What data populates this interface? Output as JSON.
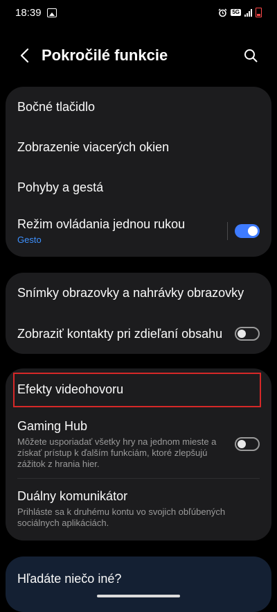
{
  "status_bar": {
    "time": "18:39",
    "network": "5G"
  },
  "header": {
    "title": "Pokročilé funkcie"
  },
  "group1": {
    "items": [
      {
        "label": "Bočné tlačidlo"
      },
      {
        "label": "Zobrazenie viacerých okien"
      },
      {
        "label": "Pohyby a gestá"
      },
      {
        "label": "Režim ovládania jednou rukou",
        "sub": "Gesto",
        "toggle": "on"
      }
    ]
  },
  "group2": {
    "items": [
      {
        "label": "Snímky obrazovky a nahrávky obrazovky"
      },
      {
        "label": "Zobraziť kontakty pri zdieľaní obsahu",
        "toggle": "off"
      }
    ]
  },
  "group3": {
    "items": [
      {
        "label": "Efekty videohovoru"
      },
      {
        "label": "Gaming Hub",
        "sub": "Môžete usporiadať všetky hry na jednom mieste a získať prístup k ďalším funkciám, ktoré zlepšujú zážitok z hrania hier.",
        "toggle": "off"
      },
      {
        "label": "Duálny komunikátor",
        "sub": "Prihláste sa k druhému kontu vo svojich obľúbených sociálnych aplikáciách."
      }
    ]
  },
  "footer_card": {
    "label": "Hľadáte niečo iné?"
  },
  "colors": {
    "accent": "#3e7bff",
    "link_blue": "#3e91ff",
    "card_bg": "#1c1c1e",
    "highlight": "#d62828"
  }
}
